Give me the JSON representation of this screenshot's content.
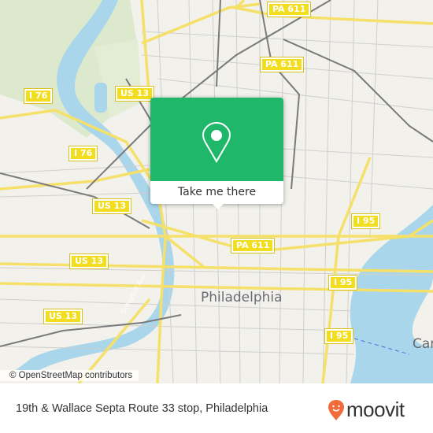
{
  "map": {
    "city_labels": [
      {
        "id": "philadelphia",
        "text": "Philadelphia"
      },
      {
        "id": "camden",
        "text": "Car"
      }
    ],
    "road_shields": [
      {
        "id": "pa611-top",
        "text": "PA 611"
      },
      {
        "id": "pa611-mid",
        "text": "PA 611"
      },
      {
        "id": "pa611-low",
        "text": "PA 611"
      },
      {
        "id": "i76-upper",
        "text": "I 76"
      },
      {
        "id": "i76-lower",
        "text": "I 76"
      },
      {
        "id": "us13-top",
        "text": "US 13"
      },
      {
        "id": "us13-mid",
        "text": "US 13"
      },
      {
        "id": "us13-left1",
        "text": "US 13"
      },
      {
        "id": "us13-left2",
        "text": "US 13"
      },
      {
        "id": "i95-upper",
        "text": "I 95"
      },
      {
        "id": "i95-mid",
        "text": "I 95"
      },
      {
        "id": "i95-low",
        "text": "I 95"
      }
    ],
    "street_label": "Schuylkill Ave",
    "attribution": "© OpenStreetMap contributors",
    "colors": {
      "land": "#f2f1ec",
      "water": "#a9d6ea",
      "park": "#d8e8c4",
      "major_road": "#f5e06a",
      "shield": "#f3dd1f",
      "rail": "#777777"
    }
  },
  "popup": {
    "icon": "location-pin-icon",
    "button_label": "Take me there",
    "color": "#1fb86a"
  },
  "footer": {
    "title": "19th & Wallace Septa Route 33 stop, Philadelphia",
    "brand": "moovit",
    "brand_color": "#f26b3a"
  }
}
